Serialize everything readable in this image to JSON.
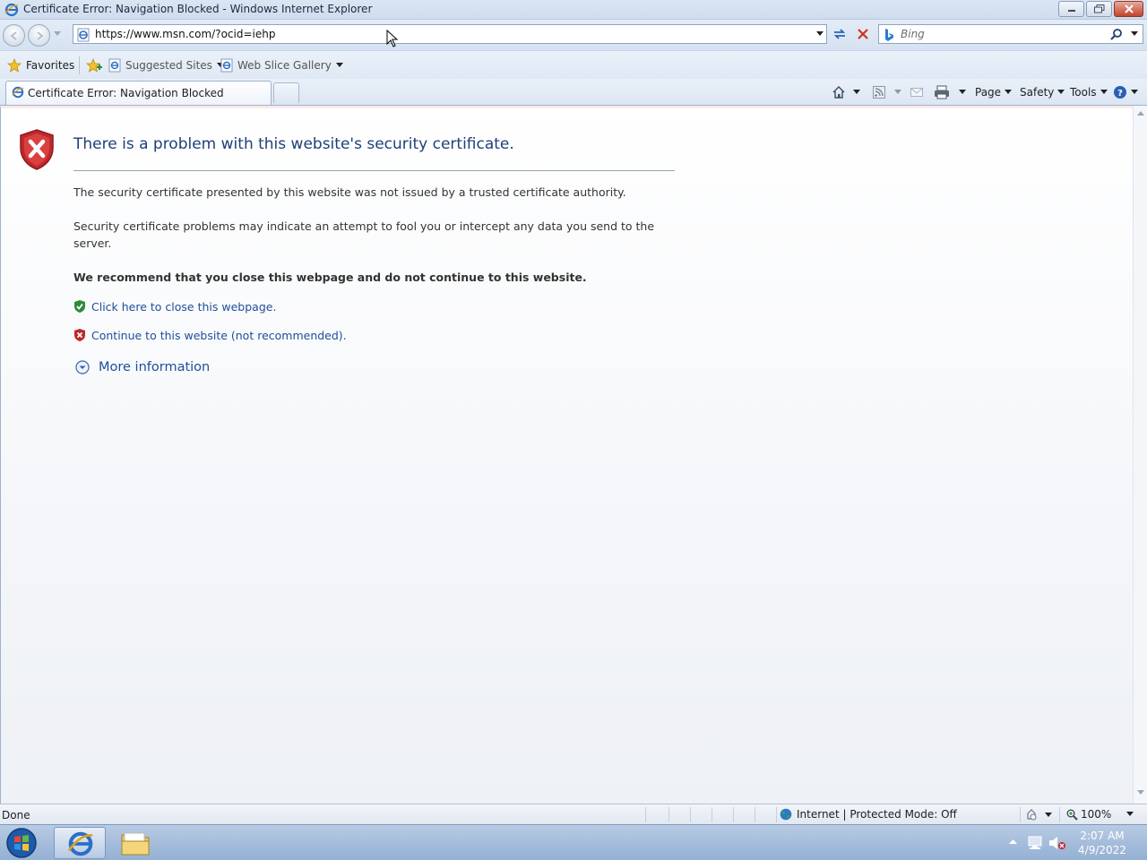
{
  "window": {
    "title": "Certificate Error: Navigation Blocked - Windows Internet Explorer"
  },
  "nav": {
    "url": "https://www.msn.com/?ocid=iehp",
    "search_placeholder": "Bing"
  },
  "favorites_bar": {
    "favorites_label": "Favorites",
    "items": [
      {
        "label": "Suggested Sites",
        "icon": "ie-page-icon"
      },
      {
        "label": "Web Slice Gallery",
        "icon": "ie-page-icon"
      }
    ]
  },
  "tabs": [
    {
      "label": "Certificate Error: Navigation Blocked",
      "active": true
    }
  ],
  "command_bar": {
    "page_label": "Page",
    "safety_label": "Safety",
    "tools_label": "Tools"
  },
  "content": {
    "heading": "There is a problem with this website's security certificate.",
    "paragraph1": "The security certificate presented by this website was not issued by a trusted certificate authority.",
    "paragraph2": "Security certificate problems may indicate an attempt to fool you or intercept any data you send to the server.",
    "recommendation": "We recommend that you close this webpage and do not continue to this website.",
    "close_link": "Click here to close this webpage.",
    "continue_link": "Continue to this website (not recommended).",
    "more_info": "More information"
  },
  "status_bar": {
    "status_text": "Done",
    "zone_text": "Internet | Protected Mode: Off",
    "zoom": "100%"
  },
  "taskbar": {
    "time": "2:07 AM",
    "date": "4/9/2022"
  },
  "colors": {
    "link": "#1f4e9a",
    "heading": "#1f3f78",
    "error_red": "#c0282b",
    "safe_green": "#2e8b3a"
  }
}
